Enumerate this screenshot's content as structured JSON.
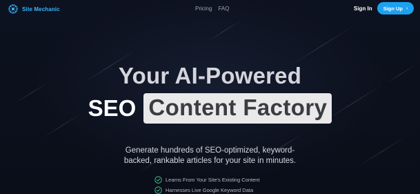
{
  "nav": {
    "brand": "Site Mechanic",
    "links": [
      "Pricing",
      "FAQ"
    ],
    "sign_in": "Sign In",
    "sign_up": "Sign Up",
    "sign_up_icon": "chevron-right-icon"
  },
  "hero": {
    "line1": "Your AI-Powered",
    "line2_prefix": "SEO",
    "line2_highlight": "Content Factory",
    "subtitle_line1": "Generate hundreds of SEO-optimized, keyword-",
    "subtitle_line2": "backed, rankable articles for your site in minutes."
  },
  "features": [
    "Learns From Your Site's Existing Content",
    "Harnesses Live Google Keyword Data"
  ],
  "colors": {
    "background": "#0b0f1a",
    "brand": "#38b6ff",
    "signup_button": "#1ea0f0",
    "highlight_bg": "#e9e9ea",
    "check": "#3fbf8a"
  }
}
